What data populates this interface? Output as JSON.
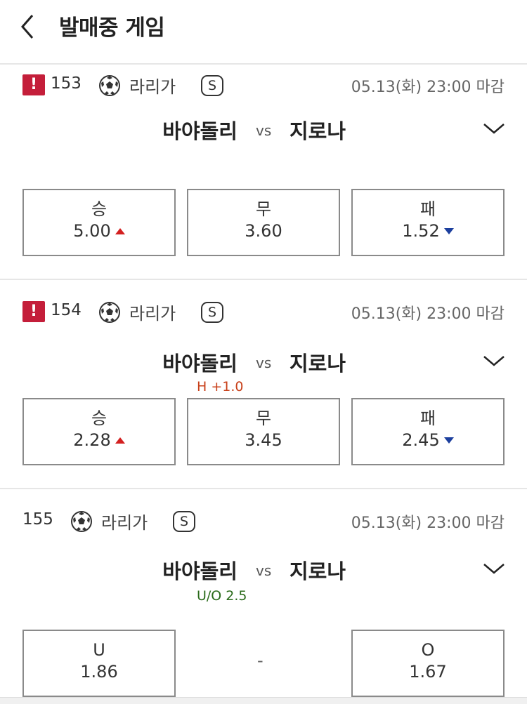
{
  "header": {
    "title": "발매중 게임",
    "back_icon": "chevron-left-icon"
  },
  "games": [
    {
      "warning": "!",
      "number": "153",
      "league": "라리가",
      "badge": "S",
      "deadline": "05.13(화) 23:00 마감",
      "home": "바야돌리",
      "vs": "vs",
      "away": "지로나",
      "sub_label": "",
      "options": [
        {
          "label": "승",
          "value": "5.00",
          "trend": "up"
        },
        {
          "label": "무",
          "value": "3.60",
          "trend": "none"
        },
        {
          "label": "패",
          "value": "1.52",
          "trend": "down"
        }
      ]
    },
    {
      "warning": "!",
      "number": "154",
      "league": "라리가",
      "badge": "S",
      "deadline": "05.13(화) 23:00 마감",
      "home": "바야돌리",
      "vs": "vs",
      "away": "지로나",
      "sub_label": "H +1.0",
      "options": [
        {
          "label": "승",
          "value": "2.28",
          "trend": "up"
        },
        {
          "label": "무",
          "value": "3.45",
          "trend": "none"
        },
        {
          "label": "패",
          "value": "2.45",
          "trend": "down"
        }
      ]
    },
    {
      "warning": "",
      "number": "155",
      "league": "라리가",
      "badge": "S",
      "deadline": "05.13(화) 23:00 마감",
      "home": "바야돌리",
      "vs": "vs",
      "away": "지로나",
      "sub_label": "U/O 2.5",
      "options": [
        {
          "label": "U",
          "value": "1.86",
          "trend": "none"
        },
        {
          "label": "",
          "value": "-",
          "trend": "none"
        },
        {
          "label": "O",
          "value": "1.67",
          "trend": "none"
        }
      ]
    }
  ],
  "colors": {
    "warning": "#c41e3a",
    "up": "#d32020",
    "down": "#1c3f9e",
    "handicap": "#c8401a",
    "overunder": "#2a6a1a"
  }
}
